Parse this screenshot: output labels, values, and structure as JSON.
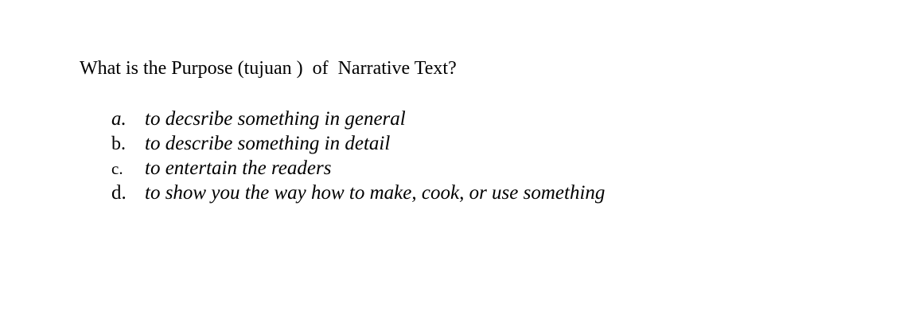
{
  "question": "What is the Purpose (tujuan )  of  Narrative Text?",
  "options": [
    {
      "letter": "a.",
      "text": "to decsribe something in general"
    },
    {
      "letter": "b.",
      "text": "to describe something in detail"
    },
    {
      "letter": "c.",
      "text": "to entertain the readers"
    },
    {
      "letter": "d.",
      "text": "to show you the way how to make, cook, or use something"
    }
  ]
}
